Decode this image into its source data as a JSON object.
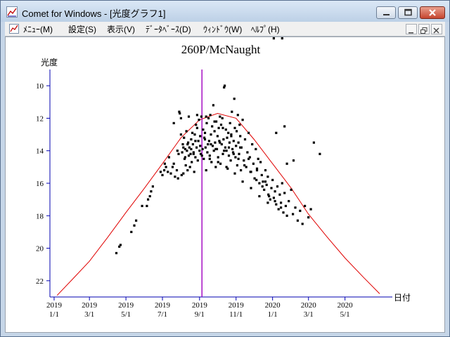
{
  "window": {
    "title": "Comet for Windows - [光度グラフ1]",
    "icon": "chart-app-icon",
    "controls": [
      "minimize-icon",
      "maximize-icon",
      "close-icon"
    ]
  },
  "menubar": {
    "items": [
      {
        "label": "ﾒﾆｭｰ(M)"
      },
      {
        "label": "設定(S)"
      },
      {
        "label": "表示(V)"
      },
      {
        "label": "ﾃﾞｰﾀﾍﾞｰｽ(D)"
      },
      {
        "label": "ｳｨﾝﾄﾞｳ(W)"
      },
      {
        "label": "ﾍﾙﾌﾟ(H)"
      }
    ],
    "mdi_controls": [
      "mdi-minimize-icon",
      "mdi-restore-icon",
      "mdi-close-icon"
    ]
  },
  "chart_data": {
    "type": "scatter",
    "title": "260P/McNaught",
    "ylabel": "光度",
    "xlabel": "日付",
    "y_inverted": true,
    "ylim": [
      23,
      9
    ],
    "yticks": [
      10,
      12,
      14,
      16,
      18,
      20,
      22
    ],
    "xlim": [
      "2018-12-25",
      "2020-07-05"
    ],
    "xticks": [
      {
        "date": "2019-01-01",
        "year": "2019",
        "day": "1/1"
      },
      {
        "date": "2019-03-01",
        "year": "2019",
        "day": "3/1"
      },
      {
        "date": "2019-05-01",
        "year": "2019",
        "day": "5/1"
      },
      {
        "date": "2019-07-01",
        "year": "2019",
        "day": "7/1"
      },
      {
        "date": "2019-09-01",
        "year": "2019",
        "day": "9/1"
      },
      {
        "date": "2019-11-01",
        "year": "2019",
        "day": "11/1"
      },
      {
        "date": "2020-01-01",
        "year": "2020",
        "day": "1/1"
      },
      {
        "date": "2020-03-01",
        "year": "2020",
        "day": "3/1"
      },
      {
        "date": "2020-05-01",
        "year": "2020",
        "day": "5/1"
      }
    ],
    "marker_date": "2019-09-05",
    "colors": {
      "model": "#e00000",
      "points": "#000000",
      "marker": "#a000c0",
      "axes": "#0000b0"
    },
    "model_curve": {
      "x": [
        "2019-01-06",
        "2019-02-01",
        "2019-03-01",
        "2019-04-01",
        "2019-05-01",
        "2019-06-01",
        "2019-07-01",
        "2019-08-01",
        "2019-09-01",
        "2019-10-01",
        "2019-11-01",
        "2019-12-01",
        "2020-01-01",
        "2020-02-01",
        "2020-03-01",
        "2020-04-01",
        "2020-05-01",
        "2020-06-01",
        "2020-06-28"
      ],
      "y": [
        22.9,
        21.9,
        20.8,
        19.3,
        17.8,
        16.3,
        14.8,
        13.2,
        12.1,
        11.7,
        12.0,
        13.3,
        14.8,
        16.3,
        17.9,
        19.3,
        20.6,
        21.8,
        22.8
      ]
    },
    "points": {
      "x": [
        "2019-04-15",
        "2019-04-20",
        "2019-04-22",
        "2019-05-10",
        "2019-05-15",
        "2019-05-18",
        "2019-05-28",
        "2019-06-05",
        "2019-06-07",
        "2019-06-10",
        "2019-06-12",
        "2019-06-15",
        "2019-06-28",
        "2019-07-01",
        "2019-07-04",
        "2019-07-05",
        "2019-07-07",
        "2019-07-10",
        "2019-07-12",
        "2019-07-15",
        "2019-07-18",
        "2019-07-20",
        "2019-07-22",
        "2019-07-25",
        "2019-07-26",
        "2019-07-27",
        "2019-07-28",
        "2019-07-29",
        "2019-07-30",
        "2019-08-01",
        "2019-08-02",
        "2019-08-03",
        "2019-08-04",
        "2019-08-05",
        "2019-08-06",
        "2019-08-07",
        "2019-08-08",
        "2019-08-09",
        "2019-08-10",
        "2019-08-11",
        "2019-08-12",
        "2019-08-13",
        "2019-08-14",
        "2019-08-15",
        "2019-08-16",
        "2019-08-17",
        "2019-08-18",
        "2019-08-19",
        "2019-08-20",
        "2019-08-21",
        "2019-08-22",
        "2019-08-23",
        "2019-08-24",
        "2019-08-25",
        "2019-08-26",
        "2019-08-27",
        "2019-08-28",
        "2019-08-29",
        "2019-08-30",
        "2019-08-31",
        "2019-09-01",
        "2019-09-02",
        "2019-09-03",
        "2019-09-04",
        "2019-09-06",
        "2019-09-07",
        "2019-09-08",
        "2019-09-09",
        "2019-09-10",
        "2019-09-11",
        "2019-09-12",
        "2019-09-13",
        "2019-09-14",
        "2019-09-15",
        "2019-09-16",
        "2019-09-17",
        "2019-09-18",
        "2019-09-19",
        "2019-09-20",
        "2019-09-21",
        "2019-09-22",
        "2019-09-23",
        "2019-09-24",
        "2019-09-25",
        "2019-09-26",
        "2019-09-27",
        "2019-09-28",
        "2019-09-29",
        "2019-09-30",
        "2019-10-01",
        "2019-10-02",
        "2019-10-03",
        "2019-10-04",
        "2019-10-05",
        "2019-10-06",
        "2019-10-07",
        "2019-10-08",
        "2019-10-09",
        "2019-10-10",
        "2019-10-11",
        "2019-10-12",
        "2019-10-13",
        "2019-10-14",
        "2019-10-15",
        "2019-10-16",
        "2019-10-17",
        "2019-10-18",
        "2019-10-19",
        "2019-10-20",
        "2019-10-21",
        "2019-10-22",
        "2019-10-23",
        "2019-10-24",
        "2019-10-25",
        "2019-10-26",
        "2019-10-27",
        "2019-10-28",
        "2019-10-29",
        "2019-10-30",
        "2019-10-31",
        "2019-11-01",
        "2019-11-02",
        "2019-11-03",
        "2019-11-04",
        "2019-11-05",
        "2019-11-06",
        "2019-11-07",
        "2019-11-08",
        "2019-11-09",
        "2019-11-10",
        "2019-11-12",
        "2019-11-14",
        "2019-11-16",
        "2019-11-18",
        "2019-11-20",
        "2019-11-22",
        "2019-11-24",
        "2019-11-26",
        "2019-11-28",
        "2019-11-30",
        "2019-12-02",
        "2019-12-04",
        "2019-12-06",
        "2019-12-08",
        "2019-12-10",
        "2019-12-12",
        "2019-12-14",
        "2019-12-16",
        "2019-12-18",
        "2019-12-20",
        "2019-12-22",
        "2019-12-24",
        "2019-12-26",
        "2019-12-28",
        "2019-12-30",
        "2020-01-01",
        "2020-01-03",
        "2020-01-05",
        "2020-01-07",
        "2020-01-09",
        "2020-01-11",
        "2020-01-13",
        "2020-01-15",
        "2020-01-17",
        "2020-01-19",
        "2020-01-21",
        "2020-01-23",
        "2020-01-25",
        "2020-01-28",
        "2020-02-01",
        "2020-02-04",
        "2020-02-08",
        "2020-02-12",
        "2020-02-16",
        "2020-02-20",
        "2020-02-24",
        "2020-03-01",
        "2020-03-05",
        "2020-03-10",
        "2020-03-20",
        "2019-08-05",
        "2019-08-12",
        "2019-08-18",
        "2019-08-25",
        "2019-09-02",
        "2019-09-10",
        "2019-09-20",
        "2019-09-28",
        "2019-10-05",
        "2019-10-12",
        "2019-10-20",
        "2019-10-28",
        "2019-11-05",
        "2019-11-15",
        "2019-11-25",
        "2019-12-05",
        "2019-12-15",
        "2019-12-25",
        "2020-01-05",
        "2020-01-15",
        "2020-01-25",
        "2020-02-05",
        "2019-08-08",
        "2019-08-22",
        "2019-09-05",
        "2019-09-18",
        "2019-10-02",
        "2019-10-16",
        "2019-10-30",
        "2019-11-12",
        "2019-11-26",
        "2019-12-10",
        "2019-12-24",
        "2020-01-07",
        "2020-01-21",
        "2019-07-20",
        "2019-08-01",
        "2019-08-14",
        "2019-08-28",
        "2019-09-12",
        "2019-09-26",
        "2019-10-10",
        "2019-10-24",
        "2019-11-08",
        "2019-11-22",
        "2019-12-06",
        "2019-12-20",
        "2020-01-03",
        "2020-01-17"
      ],
      "y": [
        20.3,
        19.9,
        19.8,
        19.0,
        18.6,
        18.3,
        17.4,
        17.4,
        17.0,
        16.8,
        16.5,
        16.2,
        15.3,
        15.5,
        15.2,
        14.8,
        15.0,
        15.3,
        14.4,
        15.4,
        15.0,
        14.8,
        15.6,
        15.2,
        14.0,
        15.7,
        14.2,
        11.6,
        11.7,
        13.0,
        15.5,
        14.1,
        13.6,
        15.4,
        13.2,
        14.5,
        13.9,
        14.9,
        12.8,
        14.0,
        15.2,
        13.5,
        14.3,
        13.8,
        15.0,
        14.2,
        13.3,
        14.7,
        12.9,
        13.6,
        14.1,
        15.3,
        13.0,
        14.4,
        12.4,
        13.8,
        12.6,
        14.6,
        13.4,
        12.1,
        14.0,
        13.1,
        14.2,
        11.9,
        13.9,
        12.7,
        14.5,
        13.2,
        12.9,
        13.8,
        15.2,
        12.3,
        14.1,
        13.6,
        12.0,
        13.4,
        14.3,
        11.8,
        13.0,
        14.7,
        12.5,
        13.7,
        11.2,
        14.0,
        12.8,
        13.5,
        15.0,
        12.2,
        13.9,
        13.1,
        14.4,
        12.6,
        13.4,
        11.9,
        14.8,
        12.4,
        13.6,
        12.0,
        14.2,
        13.3,
        10.1,
        10.0,
        13.8,
        12.7,
        14.0,
        13.2,
        15.1,
        12.9,
        14.3,
        13.5,
        12.3,
        14.6,
        13.0,
        11.6,
        13.9,
        14.1,
        13.4,
        10.8,
        12.6,
        14.4,
        13.7,
        12.8,
        14.9,
        11.8,
        13.5,
        14.2,
        12.4,
        13.1,
        15.2,
        13.8,
        12.1,
        14.6,
        13.3,
        15.0,
        14.1,
        12.9,
        14.4,
        15.3,
        13.6,
        14.8,
        15.7,
        13.9,
        15.1,
        14.5,
        16.0,
        14.7,
        15.5,
        15.9,
        16.4,
        15.2,
        16.1,
        15.6,
        16.8,
        17.0,
        16.3,
        15.8,
        16.9,
        16.5,
        17.3,
        16.2,
        17.6,
        16.7,
        17.2,
        16.0,
        17.8,
        16.6,
        17.4,
        18.0,
        17.1,
        16.4,
        17.9,
        17.5,
        18.3,
        17.7,
        18.5,
        17.4,
        18.1,
        17.6,
        13.5,
        14.2,
        13.8,
        13.6,
        13.9,
        13.4,
        13.7,
        13.3,
        13.6,
        13.9,
        13.5,
        14.0,
        13.8,
        14.2,
        14.5,
        14.9,
        15.3,
        15.8,
        16.2,
        16.7,
        17.1,
        17.5,
        14.8,
        14.6,
        14.4,
        14.2,
        14.3,
        14.5,
        14.7,
        15.0,
        15.4,
        15.9,
        16.3,
        16.8,
        17.2,
        12.9,
        12.5,
        12.3,
        12.0,
        11.9,
        11.8,
        11.9,
        12.2,
        12.6,
        13.1,
        13.8,
        14.5,
        15.2,
        15.9
      ]
    }
  }
}
